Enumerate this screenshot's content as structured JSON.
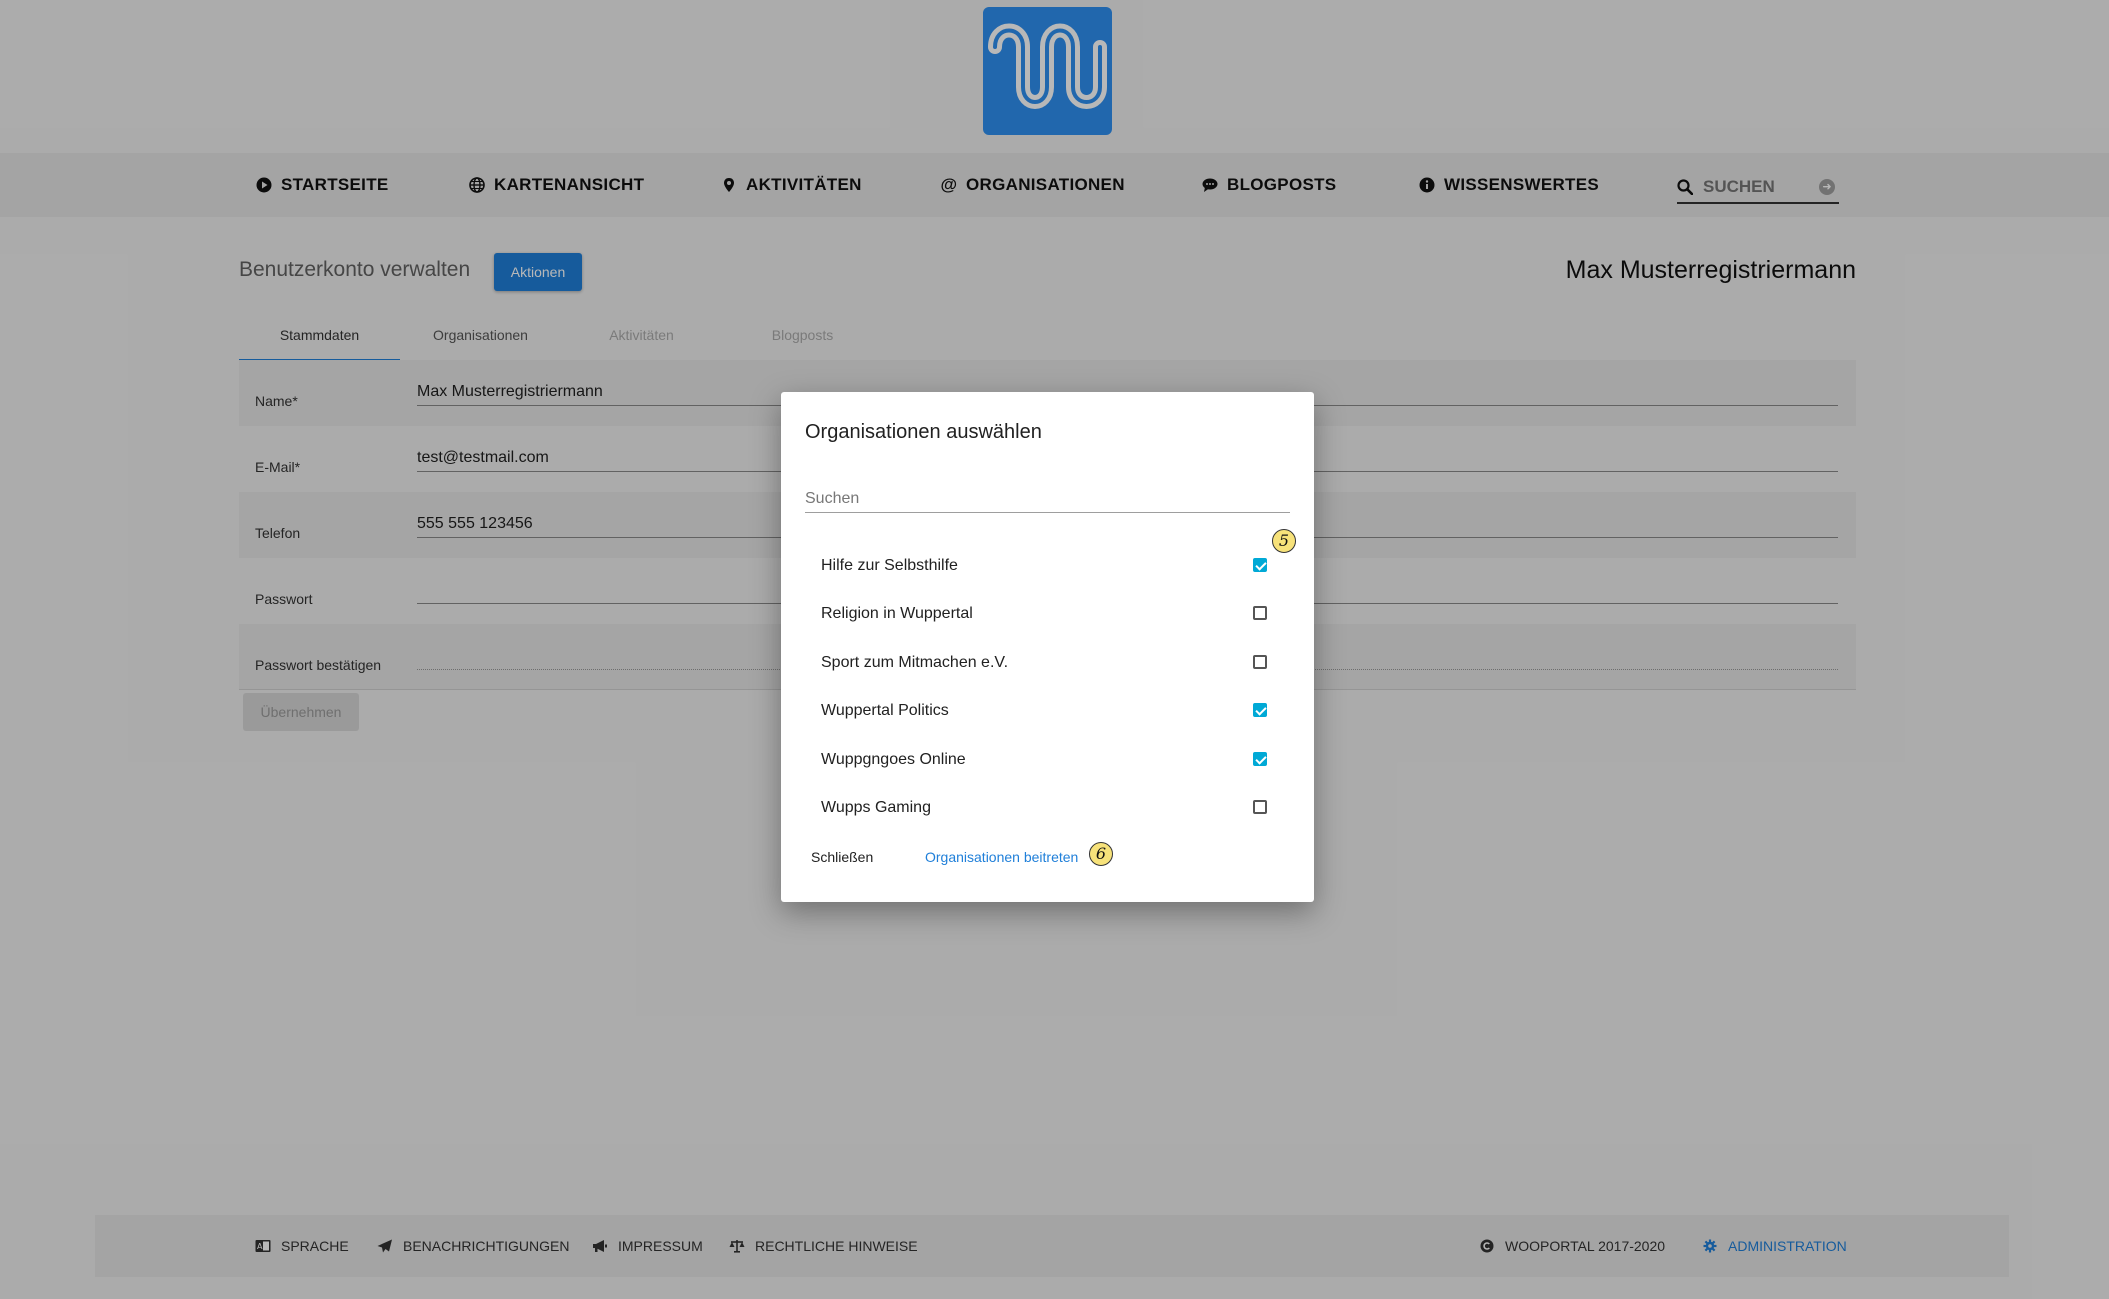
{
  "logo": {
    "name": "wooportal-logo",
    "color": "#2f8ff0"
  },
  "nav": {
    "items": [
      {
        "label": "STARTSEITE",
        "icon": "play-circle-icon"
      },
      {
        "label": "KARTENANSICHT",
        "icon": "globe-icon"
      },
      {
        "label": "AKTIVITÄTEN",
        "icon": "map-marker-icon"
      },
      {
        "label": "ORGANISATIONEN",
        "icon": "at-icon"
      },
      {
        "label": "BLOGPOSTS",
        "icon": "comment-icon"
      },
      {
        "label": "WISSENSWERTES",
        "icon": "info-circle-icon"
      }
    ],
    "search_placeholder": "SUCHEN"
  },
  "page": {
    "title": "Benutzerkonto verwalten",
    "actions_label": "Aktionen",
    "user_name": "Max Musterregistriermann",
    "tabs": [
      {
        "label": "Stammdaten",
        "state": "active"
      },
      {
        "label": "Organisationen",
        "state": "enabled"
      },
      {
        "label": "Aktivitäten",
        "state": "disabled"
      },
      {
        "label": "Blogposts",
        "state": "disabled"
      }
    ],
    "form": [
      {
        "label": "Name*",
        "value": "Max Musterregistriermann"
      },
      {
        "label": "E-Mail*",
        "value": "test@testmail.com"
      },
      {
        "label": "Telefon",
        "value": "555 555 123456"
      },
      {
        "label": "Passwort",
        "value": ""
      },
      {
        "label": "Passwort bestätigen",
        "value": ""
      }
    ],
    "apply_label": "Übernehmen"
  },
  "modal": {
    "title": "Organisationen auswählen",
    "search_placeholder": "Suchen",
    "organizations": [
      {
        "label": "Hilfe zur Selbsthilfe",
        "checked": true
      },
      {
        "label": "Religion in Wuppertal",
        "checked": false
      },
      {
        "label": "Sport zum Mitmachen e.V.",
        "checked": false
      },
      {
        "label": "Wuppertal Politics",
        "checked": true
      },
      {
        "label": "Wuppgngoes Online",
        "checked": true
      },
      {
        "label": "Wupps Gaming",
        "checked": false
      }
    ],
    "close_label": "Schließen",
    "join_label": "Organisationen beitreten",
    "markers": [
      "5",
      "6"
    ]
  },
  "footer": {
    "items": [
      {
        "label": "SPRACHE",
        "icon": "language-icon"
      },
      {
        "label": "BENACHRICHTIGUNGEN",
        "icon": "paper-plane-icon"
      },
      {
        "label": "IMPRESSUM",
        "icon": "bullhorn-icon"
      },
      {
        "label": "RECHTLICHE HINWEISE",
        "icon": "balance-scale-icon"
      }
    ],
    "copyright": "WOOPORTAL 2017-2020",
    "admin_label": "ADMINISTRATION"
  },
  "colors": {
    "accent": "#1f7fd9",
    "checkbox": "#00a9d6",
    "marker": "#f7e27a"
  }
}
